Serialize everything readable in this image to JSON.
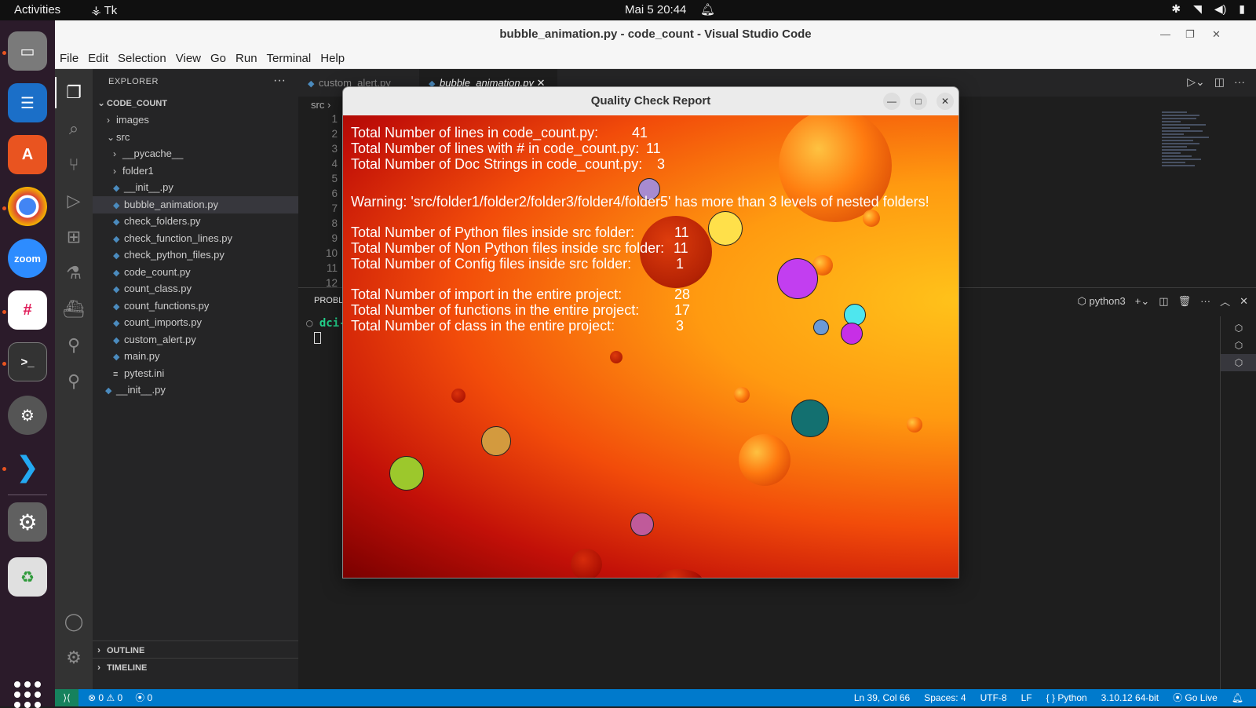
{
  "topbar": {
    "activities": "Activities",
    "app_name": "Tk",
    "app_icon": "tk-feather-icon",
    "clock": "Mai 5  20:44",
    "icons": [
      "bell-icon",
      "accessibility-icon",
      "wifi-icon",
      "volume-icon",
      "battery-icon"
    ]
  },
  "dock": {
    "apps": [
      "files-icon",
      "libreoffice-writer-icon",
      "app-center-icon",
      "chrome-icon",
      "zoom-icon",
      "slack-icon",
      "terminal-icon",
      "settings-gear-icon",
      "vscode-icon",
      "system-settings-icon",
      "trash-icon",
      "show-apps-icon"
    ],
    "zoom_label": "zoom"
  },
  "window": {
    "title": "bubble_animation.py - code_count - Visual Studio Code",
    "controls": [
      "minimize-icon",
      "maximize-icon",
      "close-icon"
    ]
  },
  "menu": [
    "File",
    "Edit",
    "Selection",
    "View",
    "Go",
    "Run",
    "Terminal",
    "Help"
  ],
  "sidebar": {
    "header": "EXPLORER",
    "root": "CODE_COUNT",
    "tree": [
      {
        "label": "images",
        "depth": 1,
        "kind": "folder"
      },
      {
        "label": "src",
        "depth": 1,
        "kind": "folder-open"
      },
      {
        "label": "__pycache__",
        "depth": 2,
        "kind": "folder"
      },
      {
        "label": "folder1",
        "depth": 2,
        "kind": "folder"
      },
      {
        "label": "__init__.py",
        "depth": 2,
        "kind": "py"
      },
      {
        "label": "bubble_animation.py",
        "depth": 2,
        "kind": "py",
        "selected": true
      },
      {
        "label": "check_folders.py",
        "depth": 2,
        "kind": "py"
      },
      {
        "label": "check_function_lines.py",
        "depth": 2,
        "kind": "py"
      },
      {
        "label": "check_python_files.py",
        "depth": 2,
        "kind": "py"
      },
      {
        "label": "code_count.py",
        "depth": 2,
        "kind": "py"
      },
      {
        "label": "count_class.py",
        "depth": 2,
        "kind": "py"
      },
      {
        "label": "count_functions.py",
        "depth": 2,
        "kind": "py"
      },
      {
        "label": "count_imports.py",
        "depth": 2,
        "kind": "py"
      },
      {
        "label": "custom_alert.py",
        "depth": 2,
        "kind": "py"
      },
      {
        "label": "main.py",
        "depth": 2,
        "kind": "py"
      },
      {
        "label": "pytest.ini",
        "depth": 2,
        "kind": "ini"
      },
      {
        "label": "__init__.py",
        "depth": 1,
        "kind": "py"
      }
    ],
    "outline": "OUTLINE",
    "timeline": "TIMELINE"
  },
  "editor": {
    "tabs": [
      {
        "label": "custom_alert.py",
        "active": false
      },
      {
        "label": "bubble_animation.py",
        "active": true
      }
    ],
    "breadcrumb": "src",
    "line_numbers": [
      "1",
      "2",
      "3",
      "4",
      "5",
      "6",
      "7",
      "8",
      "9",
      "10",
      "11",
      "12"
    ]
  },
  "panel": {
    "tab_label": "PROBL",
    "terminal_prompt": "dci-",
    "shell": "python3"
  },
  "statusbar": {
    "errors": "0",
    "warnings": "0",
    "ports": "0",
    "position": "Ln 39, Col 66",
    "spaces": "Spaces: 4",
    "encoding": "UTF-8",
    "eol": "LF",
    "language": "Python",
    "interpreter": "3.10.12 64-bit",
    "golive": "Go Live"
  },
  "dialog": {
    "title": "Quality Check Report",
    "lines": [
      {
        "text": "Total Number of lines in code_count.py:",
        "value": "41"
      },
      {
        "text": "Total Number of lines with # in code_count.py:",
        "value": "11"
      },
      {
        "text": "Total Number of Doc Strings in code_count.py:",
        "value": "3"
      },
      {
        "text": "Warning: 'src/folder1/folder2/folder3/folder4/folder5' has more than 3 levels of nested folders!",
        "value": ""
      },
      {
        "text": "Total Number of Python files inside src folder:",
        "value": "11"
      },
      {
        "text": "Total Number of Non Python files inside src folder:",
        "value": "11"
      },
      {
        "text": "Total Number of Config files inside src folder:",
        "value": "1"
      },
      {
        "text": "Total Number of import in the entire project:",
        "value": "28"
      },
      {
        "text": "Total Number of functions in the entire project:",
        "value": "17"
      },
      {
        "text": "Total Number of class in the entire project:",
        "value": "3"
      }
    ],
    "bubble_colors": [
      "#a78bd0",
      "#ffe04a",
      "#c23ef0",
      "#4ee6ee",
      "#6b9ad6",
      "#c72fe6",
      "#137070",
      "#d39a3e",
      "#9cc82c",
      "#c05a9a"
    ]
  }
}
